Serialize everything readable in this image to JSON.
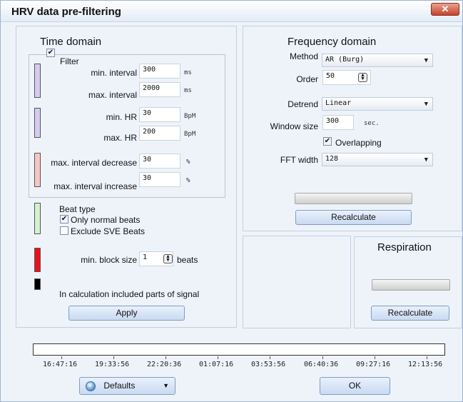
{
  "window": {
    "title": "HRV data pre-filtering",
    "close_glyph": "✕"
  },
  "time_domain": {
    "title": "Time domain",
    "filter_label": "Filter",
    "filter_checked": true,
    "fields": [
      {
        "label": "min. interval",
        "value": "300",
        "unit": "ms"
      },
      {
        "label": "max. interval",
        "value": "2000",
        "unit": "ms"
      },
      {
        "label": "min. HR",
        "value": "30",
        "unit": "BpM"
      },
      {
        "label": "max. HR",
        "value": "200",
        "unit": "BpM"
      },
      {
        "label": "max. interval decrease",
        "value": "30",
        "unit": "%"
      },
      {
        "label": "max. interval increase",
        "value": "30",
        "unit": "%"
      }
    ],
    "beat_type": {
      "label": "Beat type",
      "only_normal": {
        "label": "Only normal beats",
        "checked": true
      },
      "exclude_sve": {
        "label": "Exclude SVE Beats",
        "checked": false
      }
    },
    "min_block": {
      "label": "min. block size",
      "value": "1",
      "unit": "beats"
    },
    "included_parts_label": "In calculation included parts of signal",
    "apply_label": "Apply",
    "colors": {
      "interval": "#d6ccf1",
      "hr": "#d6ccf1",
      "change": "#f6c7c3",
      "beat": "#d3f2cf",
      "block": "#e8121b",
      "included": "#000000"
    }
  },
  "frequency_domain": {
    "title": "Frequency domain",
    "method": {
      "label": "Method",
      "value": "AR (Burg)"
    },
    "order": {
      "label": "Order",
      "value": "50"
    },
    "detrend": {
      "label": "Detrend",
      "value": "Linear"
    },
    "window_size": {
      "label": "Window size",
      "value": "300",
      "unit": "sec."
    },
    "overlapping": {
      "label": "Overlapping",
      "checked": true
    },
    "fft_width": {
      "label": "FFT width",
      "value": "128"
    },
    "recalculate_label": "Recalculate"
  },
  "respiration": {
    "title": "Respiration",
    "recalculate_label": "Recalculate"
  },
  "timeline": {
    "labels": [
      "16:47:16",
      "19:33:56",
      "22:20:36",
      "01:07:16",
      "03:53:56",
      "06:40:36",
      "09:27:16",
      "12:13:56"
    ]
  },
  "footer": {
    "defaults_label": "Defaults",
    "ok_label": "OK"
  }
}
